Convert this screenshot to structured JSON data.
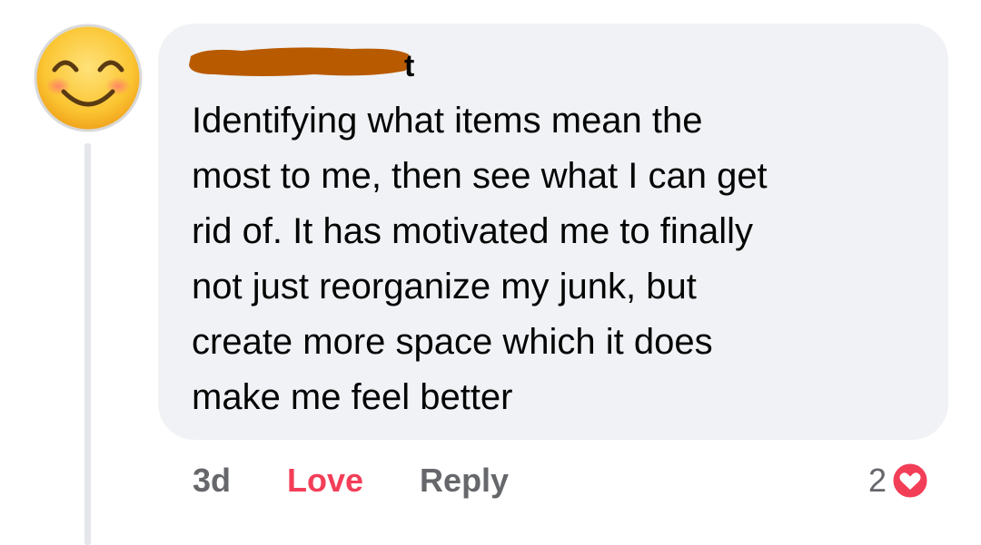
{
  "comment": {
    "author_visible_fragment": "t",
    "text": "Identifying what items mean the\nmost to me, then see what I can get\nrid of.  It has motivated me to finally\nnot just reorganize my junk, but\ncreate more space which it does\nmake me feel better",
    "avatar_icon": "smiling-face-emoji-icon",
    "redaction_color": "#b85a00"
  },
  "actions": {
    "timestamp": "3d",
    "reaction_label": "Love",
    "reply_label": "Reply"
  },
  "reactions": {
    "count": "2",
    "icon": "heart-reaction-icon",
    "color": "#f33e58"
  }
}
